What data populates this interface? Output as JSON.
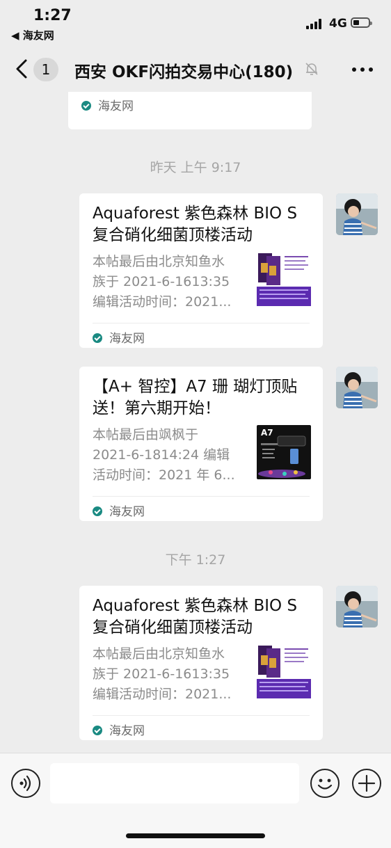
{
  "status_bar": {
    "time": "1:27",
    "back_app": "◀ 海友网",
    "network": "4G"
  },
  "nav": {
    "unread_count": "1",
    "title": "西安 OKF闪拍交易中心(180)"
  },
  "colors": {
    "background": "#ededed",
    "bubble": "#ffffff",
    "source_icon": "#1a8a82",
    "timestamp": "#a5a5a5"
  },
  "messages": [
    {
      "source": "海友网"
    },
    {
      "timestamp": "昨天 上午 9:17"
    },
    {
      "title": "Aquaforest 紫色森林 BIO S 复合硝化细菌顶楼活动",
      "desc": [
        "本帖最后由北京知鱼水",
        "族于 2021-6-1613:35",
        "编辑活动时间：2021..."
      ],
      "source": "海友网"
    },
    {
      "title": "【A+ 智控】A7 珊 瑚灯顶贴送！第六期开始！",
      "desc": [
        "本帖最后由飒枫于",
        "2021-6-1814:24 编辑",
        "活动时间：2021 年 6..."
      ],
      "thumb_label": "A7",
      "source": "海友网"
    },
    {
      "timestamp": "下午 1:27"
    },
    {
      "title": "Aquaforest 紫色森林 BIO S 复合硝化细菌顶楼活动",
      "desc": [
        "本帖最后由北京知鱼水",
        "族于 2021-6-1613:35",
        "编辑活动时间：2021..."
      ],
      "source": "海友网"
    }
  ],
  "icons": {
    "back": "chevron-left-icon",
    "mute": "bell-off-icon",
    "more": "more-icon",
    "voice": "voice-icon",
    "emoji": "emoji-icon",
    "plus": "plus-icon"
  }
}
